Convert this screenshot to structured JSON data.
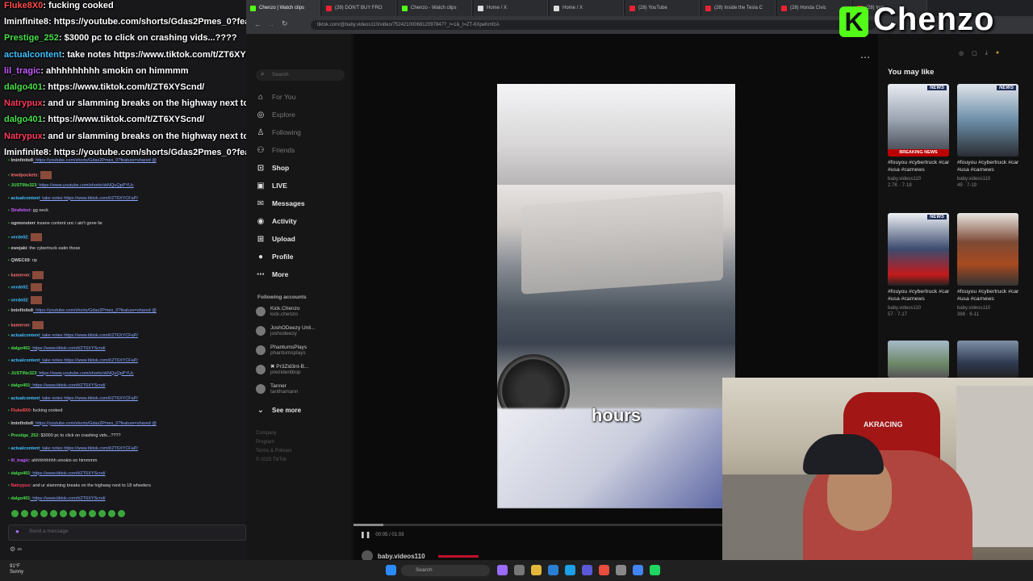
{
  "browser": {
    "tabs": [
      {
        "label": "Chenzo | Watch clips",
        "color": "#53fc18"
      },
      {
        "label": "(28) DON'T BUY FRO",
        "color": "#e23"
      },
      {
        "label": "Chenzo - Watch clips",
        "color": "#53fc18"
      },
      {
        "label": "Home / X",
        "color": "#ddd"
      },
      {
        "label": "Home / X",
        "color": "#ddd"
      },
      {
        "label": "(28) YouTube",
        "color": "#e23"
      },
      {
        "label": "(28) Inside the Tesla C",
        "color": "#e23"
      },
      {
        "label": "(28) Honda Civic",
        "color": "#e23"
      },
      {
        "label": "(28) Inst",
        "color": "#e23"
      }
    ],
    "url": "tiktok.com/@baby.videos110/video/7524210006812097847?_r=1&_t=ZT-6XpeKmfzA"
  },
  "nav": {
    "search_placeholder": "Search",
    "items": [
      {
        "label": "For You",
        "icon": "home-icon",
        "glyph": "⌂"
      },
      {
        "label": "Explore",
        "icon": "compass-icon",
        "glyph": "◎"
      },
      {
        "label": "Following",
        "icon": "following-icon",
        "glyph": "♙"
      },
      {
        "label": "Friends",
        "icon": "friends-icon",
        "glyph": "⚇"
      },
      {
        "label": "Shop",
        "icon": "shop-icon",
        "glyph": "⊡"
      },
      {
        "label": "LIVE",
        "icon": "live-icon",
        "glyph": "▣"
      },
      {
        "label": "Messages",
        "icon": "messages-icon",
        "glyph": "✉"
      },
      {
        "label": "Activity",
        "icon": "activity-icon",
        "glyph": "◉"
      },
      {
        "label": "Upload",
        "icon": "upload-icon",
        "glyph": "⊞"
      },
      {
        "label": "Profile",
        "icon": "profile-icon",
        "glyph": "●"
      },
      {
        "label": "More",
        "icon": "more-icon",
        "glyph": "⋯"
      }
    ],
    "following_header": "Following accounts",
    "following": [
      {
        "name": "Kick.Chenzo",
        "handle": "kick.chenzo"
      },
      {
        "name": "JoshODeezy Unli...",
        "handle": "joshodeezy"
      },
      {
        "name": "PhantumsPlays",
        "handle": "phantumsplays"
      },
      {
        "name": "✖ Pr3Zid3nt-B...",
        "handle": "prezidentbop"
      },
      {
        "name": "Tanner",
        "handle": "tanthamann"
      }
    ],
    "see_more": "See more",
    "footer": [
      "Company",
      "Program",
      "Terms & Policies",
      "© 2025 TikTok"
    ]
  },
  "video": {
    "caption": "hours",
    "time": "00:05 / 01:03",
    "progress": 0.08,
    "author": "baby.videos110"
  },
  "side": {
    "title": "You may like",
    "thumbs": [
      {
        "caption": "#fouyou #cybertruck #car #usa #carnews",
        "meta": "baby.videos110",
        "stats": "2.7K · 7-18",
        "badge": "NEWS",
        "breaking": "BREAKING NEWS",
        "bg": "linear-gradient(180deg,#e8ecf3,#9aa3b1 50%,#3c3f48)"
      },
      {
        "caption": "#fouyou #cybertruck #car #usa #carnews",
        "meta": "baby.videos110",
        "stats": "49 · 7-19",
        "badge": "NEWS",
        "breaking": "",
        "bg": "linear-gradient(180deg,#dfe3ea,#6c8ea8 50%,#2b2d33)"
      },
      {
        "caption": "#fouyou #cybertruck #car #usa #carnews",
        "meta": "baby.videos110",
        "stats": "57 · 7-17",
        "badge": "NEWS",
        "breaking": "",
        "bg": "linear-gradient(180deg,#eef0f4,#3b4b6e 50%,#c31a1a 85%,#222)"
      },
      {
        "caption": "#fouyou #cybertruck #car #usa #carnews",
        "meta": "baby.videos110",
        "stats": "388 · 6-11",
        "badge": "",
        "breaking": "",
        "bg": "linear-gradient(180deg,#e9e6e2,#7d4a36 40%,#a84a20 70%,#333)"
      },
      {
        "caption": "",
        "meta": "",
        "stats": "",
        "badge": "",
        "breaking": "",
        "bg": "linear-gradient(180deg,#a6b9c9,#6f8a6a 60%,#555)"
      },
      {
        "caption": "",
        "meta": "",
        "stats": "",
        "badge": "",
        "breaking": "",
        "bg": "linear-gradient(180deg,#7d8fa6,#2f3a52 60%,#222)"
      }
    ]
  },
  "chat": {
    "overlay": [
      {
        "user": "Fluke8X0",
        "text": ": fucking cooked",
        "color": "#ff4d4d"
      },
      {
        "user": "lminfinite8",
        "text": ": https://youtube.com/shorts/Gdas2Pmes_0?feature=shared @",
        "color": "#ffffff"
      },
      {
        "user": "Prestige_252",
        "text": ": $3000 pc to click on crashing vids...????",
        "color": "#4ae04a"
      },
      {
        "user": "actualcontent",
        "text": ": take notes https://www.tiktok.com/t/ZT6XYCFaP/",
        "color": "#3fc1ff"
      },
      {
        "user": "lil_tragic",
        "text": ": ahhhhhhhhh smokin on himmmm",
        "color": "#c65cff"
      },
      {
        "user": "dalgo401",
        "text": ": https://www.tiktok.com/t/ZT6XYScnd/",
        "color": "#4ae04a"
      },
      {
        "user": "Natrypux",
        "text": ": and ur slamming breaks on the highway next to 18 wheelers",
        "color": "#ff3b5c"
      },
      {
        "user": "dalgo401",
        "text": ": https://www.tiktok.com/t/ZT6XYScnd/",
        "color": "#4ae04a"
      },
      {
        "user": "Natrypux",
        "text": ": and ur slamming breaks on the highway next to 18 wheelers",
        "color": "#ff3b5c"
      },
      {
        "user": "lminfinite8",
        "text": ": https://youtube.com/shorts/Gdas2Pmes_0?feature=shared @",
        "color": "#ffffff"
      }
    ],
    "messages": [
      {
        "user": "lminfinite8",
        "text": ": https://youtube.com/shorts/Gdas2Pmes_0?feature=shared @",
        "color": "#cccccc",
        "link": true
      },
      {
        "user": "lewdpockets",
        "text": ":",
        "color": "#ff6b6b",
        "link": false,
        "emote": true
      },
      {
        "user": "JUSTINx323",
        "text": ": https://www.youtube.com/shorts/vkNQuQpPYUc",
        "color": "#4ae04a",
        "link": true
      },
      {
        "user": "actualcontent",
        "text": ": take notes https://www.tiktok.com/t/ZT6XYCFaP/",
        "color": "#3fc1ff",
        "link": true
      },
      {
        "user": "Strafebot",
        "text": ": gg neck",
        "color": "#c65cff",
        "link": false
      },
      {
        "user": "ogmonsterr",
        "text": " insane content unc i ain't gone lie",
        "color": "#cccccc",
        "link": false
      },
      {
        "user": "verde02",
        "text": ":",
        "color": "#3fc1ff",
        "link": false,
        "emote": true
      },
      {
        "user": "ewojaki",
        "text": ": the cybertruck eatin those",
        "color": "#cccccc",
        "link": false
      },
      {
        "user": "QWEC69",
        "text": ": rip",
        "color": "#cccccc",
        "link": false
      },
      {
        "user": "kameron",
        "text": ":",
        "color": "#ff6b6b",
        "link": false,
        "emote": true
      },
      {
        "user": "verde02",
        "text": ":",
        "color": "#3fc1ff",
        "link": false,
        "emote": true
      },
      {
        "user": "verde02",
        "text": ":",
        "color": "#3fc1ff",
        "link": false,
        "emote": true
      },
      {
        "user": "lminfinite8",
        "text": ": https://youtube.com/shorts/Gdas2Pmes_0?feature=shared @",
        "color": "#cccccc",
        "link": true
      },
      {
        "user": "kameron",
        "text": ":",
        "color": "#ff6b6b",
        "link": false,
        "emote": true
      },
      {
        "user": "actualcontent",
        "text": ": take notes https://www.tiktok.com/t/ZT6XYCFaP/",
        "color": "#3fc1ff",
        "link": true
      },
      {
        "user": "dalgo401",
        "text": ": https://www.tiktok.com/t/ZT6XYScnd/",
        "color": "#4ae04a",
        "link": true
      },
      {
        "user": "actualcontent",
        "text": ": take notes https://www.tiktok.com/t/ZT6XYCFaP/",
        "color": "#3fc1ff",
        "link": true
      },
      {
        "user": "JUSTINx323",
        "text": ": https://www.youtube.com/shorts/vkNQuQpPYUc",
        "color": "#4ae04a",
        "link": true
      },
      {
        "user": "dalgo401",
        "text": ": https://www.tiktok.com/t/ZT6XYScnd/",
        "color": "#4ae04a",
        "link": true
      },
      {
        "user": "actualcontent",
        "text": ": take notes https://www.tiktok.com/t/ZT6XYCFaP/",
        "color": "#3fc1ff",
        "link": true
      },
      {
        "user": "Fluke8X0",
        "text": ": fucking cooked",
        "color": "#ff4d4d",
        "link": false
      },
      {
        "user": "lminfinite8",
        "text": ": https://youtube.com/shorts/Gdas2Pmes_0?feature=shared @",
        "color": "#cccccc",
        "link": true
      },
      {
        "user": "Prestige_252",
        "text": ": $3000 pc to click on crashing vids...????",
        "color": "#4ae04a",
        "link": false
      },
      {
        "user": "actualcontent",
        "text": ": take notes https://www.tiktok.com/t/ZT6XYCFaP/",
        "color": "#3fc1ff",
        "link": true
      },
      {
        "user": "lil_tragic",
        "text": ": ahhhhhhhhh smokin on himmmm",
        "color": "#c65cff",
        "link": false
      },
      {
        "user": "dalgo401",
        "text": ": https://www.tiktok.com/t/ZT6XYScnd/",
        "color": "#4ae04a",
        "link": true
      },
      {
        "user": "Natrypux",
        "text": ": and ur slamming breaks on the highway next to 18 wheelers",
        "color": "#ff3b5c",
        "link": false
      },
      {
        "user": "dalgo401",
        "text": ": https://www.tiktok.com/t/ZT6XYScnd/",
        "color": "#4ae04a",
        "link": true
      }
    ],
    "input_placeholder": "Send a message",
    "bottom": "⚙ ∞"
  },
  "overlay_logo": {
    "k": "K",
    "name": "Chenzo"
  },
  "cam": {
    "chair_label": "AKRACING"
  },
  "taskbar": {
    "weather": [
      "91°F",
      "Sunny"
    ],
    "search": "Search",
    "icon_colors": [
      "#2a8cff",
      "#555",
      "#9b6bff",
      "#777",
      "#e4b63a",
      "#2a7fd4",
      "#1ca0e6",
      "#5a5ad8",
      "#e84d3d",
      "#888",
      "#4285f4",
      "#1ed760"
    ]
  },
  "colors": {
    "accent": "#53fc18",
    "tiktok_red": "#fe2c55"
  }
}
